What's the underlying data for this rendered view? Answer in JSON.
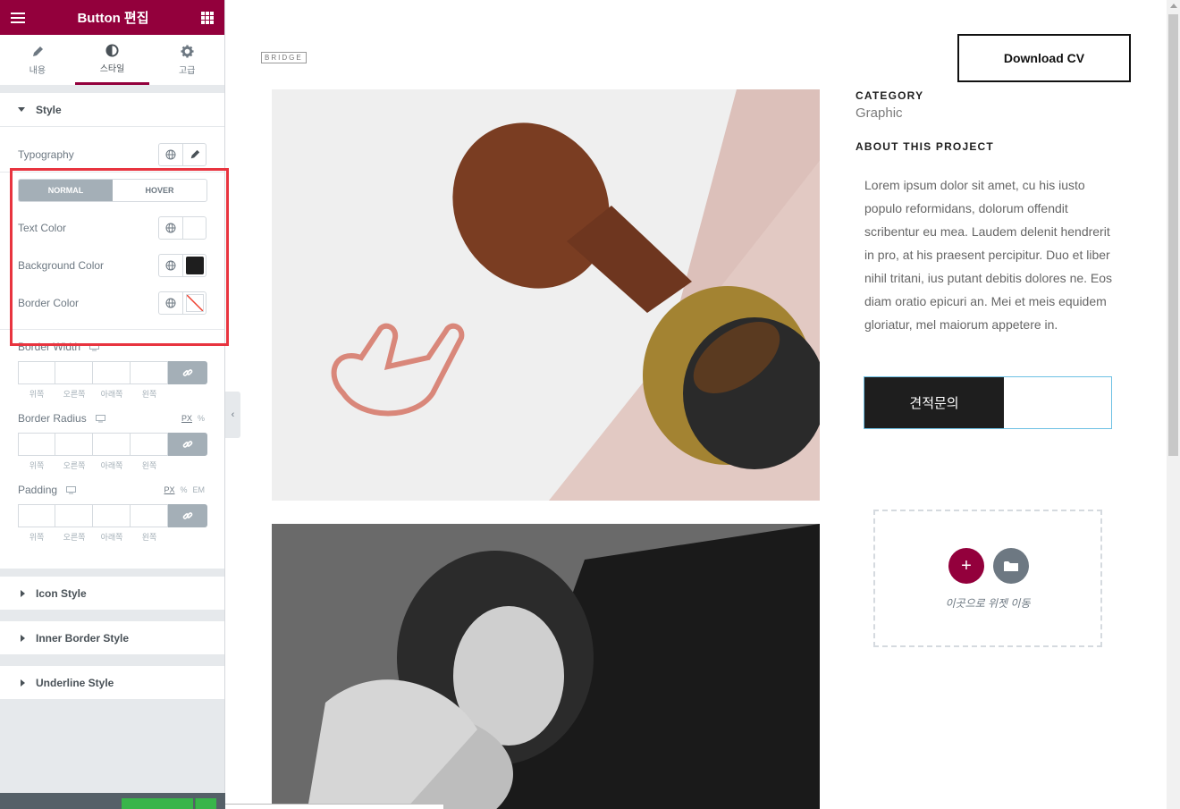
{
  "panel": {
    "title": "Button 편집",
    "tabs": [
      {
        "label": "내용",
        "icon": "pencil-icon"
      },
      {
        "label": "스타일",
        "icon": "half-circle-icon",
        "active": true
      },
      {
        "label": "고급",
        "icon": "gear-icon"
      }
    ],
    "style_section": {
      "title": "Style",
      "typography_label": "Typography",
      "state_tabs": {
        "normal": "NORMAL",
        "hover": "HOVER",
        "active": "NORMAL"
      },
      "text_color_label": "Text Color",
      "background_color_label": "Background Color",
      "background_color_value": "#1e1e1e",
      "border_color_label": "Border Color",
      "border_width": {
        "label": "Border Width",
        "sides": [
          "위쪽",
          "오른쪽",
          "아래쪽",
          "왼쪽"
        ]
      },
      "border_radius": {
        "label": "Border Radius",
        "units": [
          "PX",
          "%"
        ],
        "sides": [
          "위쪽",
          "오른쪽",
          "아래쪽",
          "왼쪽"
        ]
      },
      "padding": {
        "label": "Padding",
        "units": [
          "PX",
          "%",
          "EM"
        ],
        "sides": [
          "위쪽",
          "오른쪽",
          "아래쪽",
          "왼쪽"
        ]
      }
    },
    "collapsed_sections": [
      "Icon Style",
      "Inner Border Style",
      "Underline Style"
    ]
  },
  "preview": {
    "logo": "BRIDGE",
    "download_button": "Download CV",
    "category_label": "CATEGORY",
    "category_value": "Graphic",
    "about_label": "ABOUT THIS PROJECT",
    "about_text": "Lorem ipsum dolor sit amet, cu his iusto populo reformidans, dolorum offendit scribentur eu mea. Laudem delenit hendrerit in pro, at his praesent percipitur. Duo et liber nihil tritani, ius putant debitis dolores ne. Eos diam oratio epicuri an. Mei et meis equidem gloriatur, mel maiorum appetere in.",
    "quote_button": "견적문의",
    "drop_zone": {
      "add_label": "+",
      "text": "이곳으로 위젯 이동"
    }
  },
  "colors": {
    "brand": "#93003c",
    "highlight": "#e8343f",
    "button_bg": "#1e1e1e",
    "selection": "#6ec1e4"
  }
}
